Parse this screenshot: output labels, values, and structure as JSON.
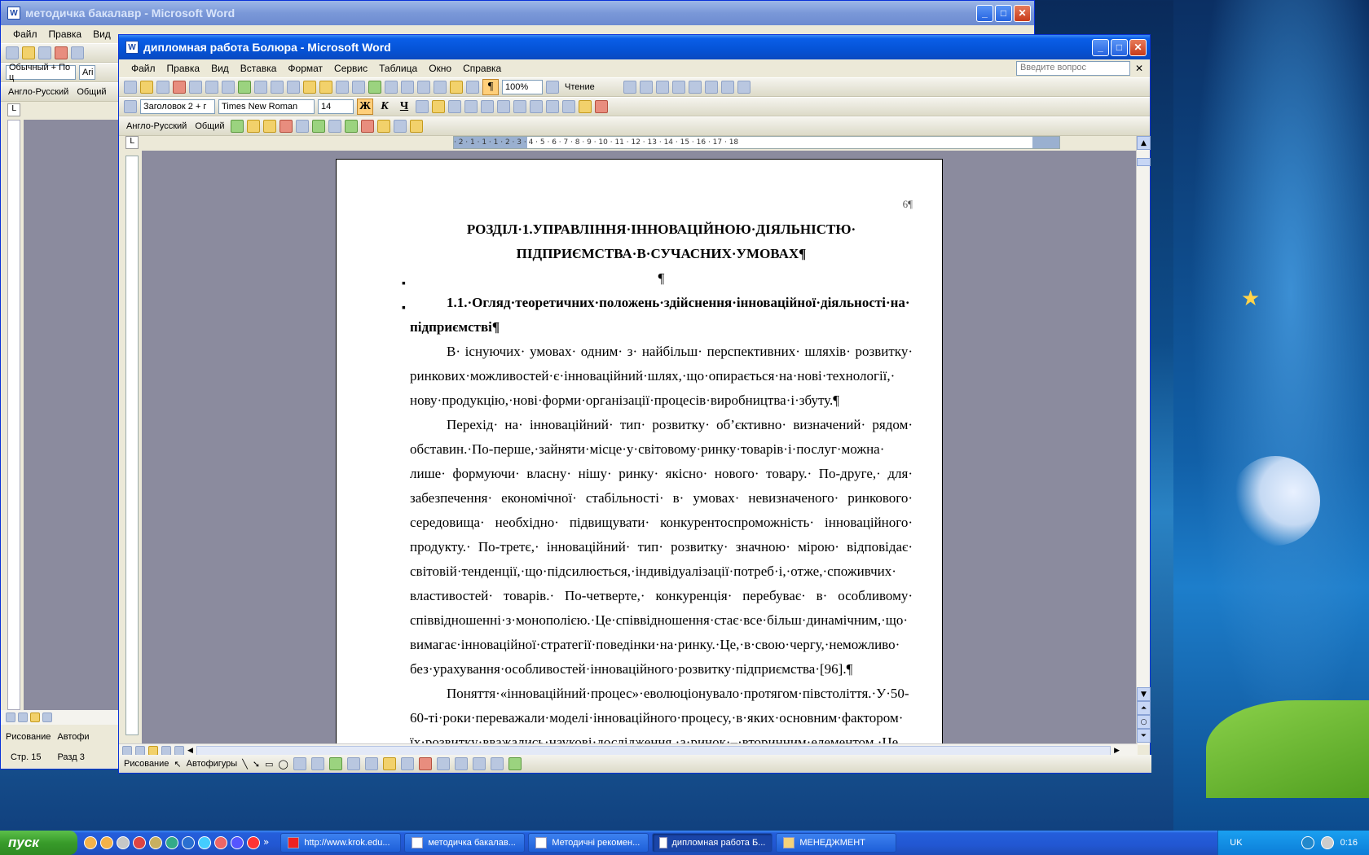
{
  "back_window": {
    "title": "методичка бакалавр - Microsoft Word",
    "menu": [
      "Файл",
      "Правка",
      "Вид"
    ],
    "style_select": "Обычный + По ц",
    "font_select": "Ari",
    "lang_dropdown": "Англо-Русский",
    "general_dropdown": "Общий",
    "status_page": "Стр. 15",
    "status_section": "Разд 3",
    "draw_label": "Рисование",
    "autoshapes_label": "Автофи"
  },
  "front_window": {
    "title": "дипломная работа Болюра - Microsoft Word",
    "menu": [
      "Файл",
      "Правка",
      "Вид",
      "Вставка",
      "Формат",
      "Сервис",
      "Таблица",
      "Окно",
      "Справка"
    ],
    "ask_placeholder": "Введите вопрос",
    "zoom": "100%",
    "reading_label": "Чтение",
    "style_select": "Заголовок 2 + г",
    "font_select": "Times New Roman",
    "size_select": "14",
    "bold_label": "Ж",
    "italic_label": "К",
    "underline_label": "Ч",
    "lang_dropdown": "Англо-Русский",
    "general_dropdown": "Общий",
    "draw_label": "Рисование",
    "autoshapes_label": "Автофигуры",
    "ruler_text": "· 2 · 1 · 1 · 1 · 2 · 3 · 4 · 5 · 6 · 7 · 8 · 9 · 10 · 11 · 12 · 13 · 14 · 15 · 16 · 17 · 18",
    "document": {
      "page_number": "6¶",
      "heading1_line1": "РОЗДІЛ·1.УПРАВЛІННЯ·ІННОВАЦІЙНОЮ·ДІЯЛЬНІСТЮ·",
      "heading1_line2": "ПІДПРИЄМСТВА·В·СУЧАСНИХ·УМОВАХ¶",
      "empty_para": "¶",
      "heading2": "1.1.·Огляд·теоретичних·положень·здійснення·інноваційної·діяльності·на· підприємстві¶",
      "para1": "В· існуючих· умовах· одним· з· найбільш· перспективних· шляхів· розвитку· ринкових·можливостей·є·інноваційний·шлях,·що·опирається·на·нові·технології,· нову·продукцію,·нові·форми·організації·процесів·виробництва·і·збуту.¶",
      "para2": "Перехід· на· інноваційний· тип· розвитку· об’єктивно· визначений· рядом· обставин.·По-перше,·зайняти·місце·у·світовому·ринку·товарів·і·послуг·можна· лише· формуючи· власну· нішу· ринку· якісно· нового· товару.· По-друге,· для· забезпечення· економічної· стабільності· в· умовах· невизначеного· ринкового· середовища· необхідно· підвищувати· конкурентоспроможність· інноваційного· продукту.· По-третє,· інноваційний· тип· розвитку· значною· мірою· відповідає· світовій·тенденції,·що·підсилюється,·індивідуалізації·потреб·і,·отже,·споживчих· властивостей· товарів.· По-четверте,· конкуренція· перебуває· в· особливому· співвідношенні·з·монополією.·Це·співвідношення·стає·все·більш·динамічним,·що· вимагає·інноваційної·стратегії·поведінки·на·ринку.·Це,·в·свою·чергу,·неможливо· без·урахування·особливостей·інноваційного·розвитку·підприємства·[96].¶",
      "para3": "Поняття·«інноваційний·процес»·еволюціонувало·протягом·півстоліття.·У·50-60-ті·роки·переважали·моделі·інноваційного·процесу,·в·яких·основним·фактором· їх·розвитку·вважались·наукові·дослідження,·а·ринок·–·вторинним·елементом.·Це"
    }
  },
  "taskbar": {
    "start_label": "пуск",
    "tasks": [
      "http://www.krok.edu...",
      "методичка бакалав...",
      "Методичні рекомен...",
      "дипломная работа Б...",
      "МЕНЕДЖМЕНТ"
    ],
    "tray_lang": "UK",
    "clock": "0:16"
  }
}
